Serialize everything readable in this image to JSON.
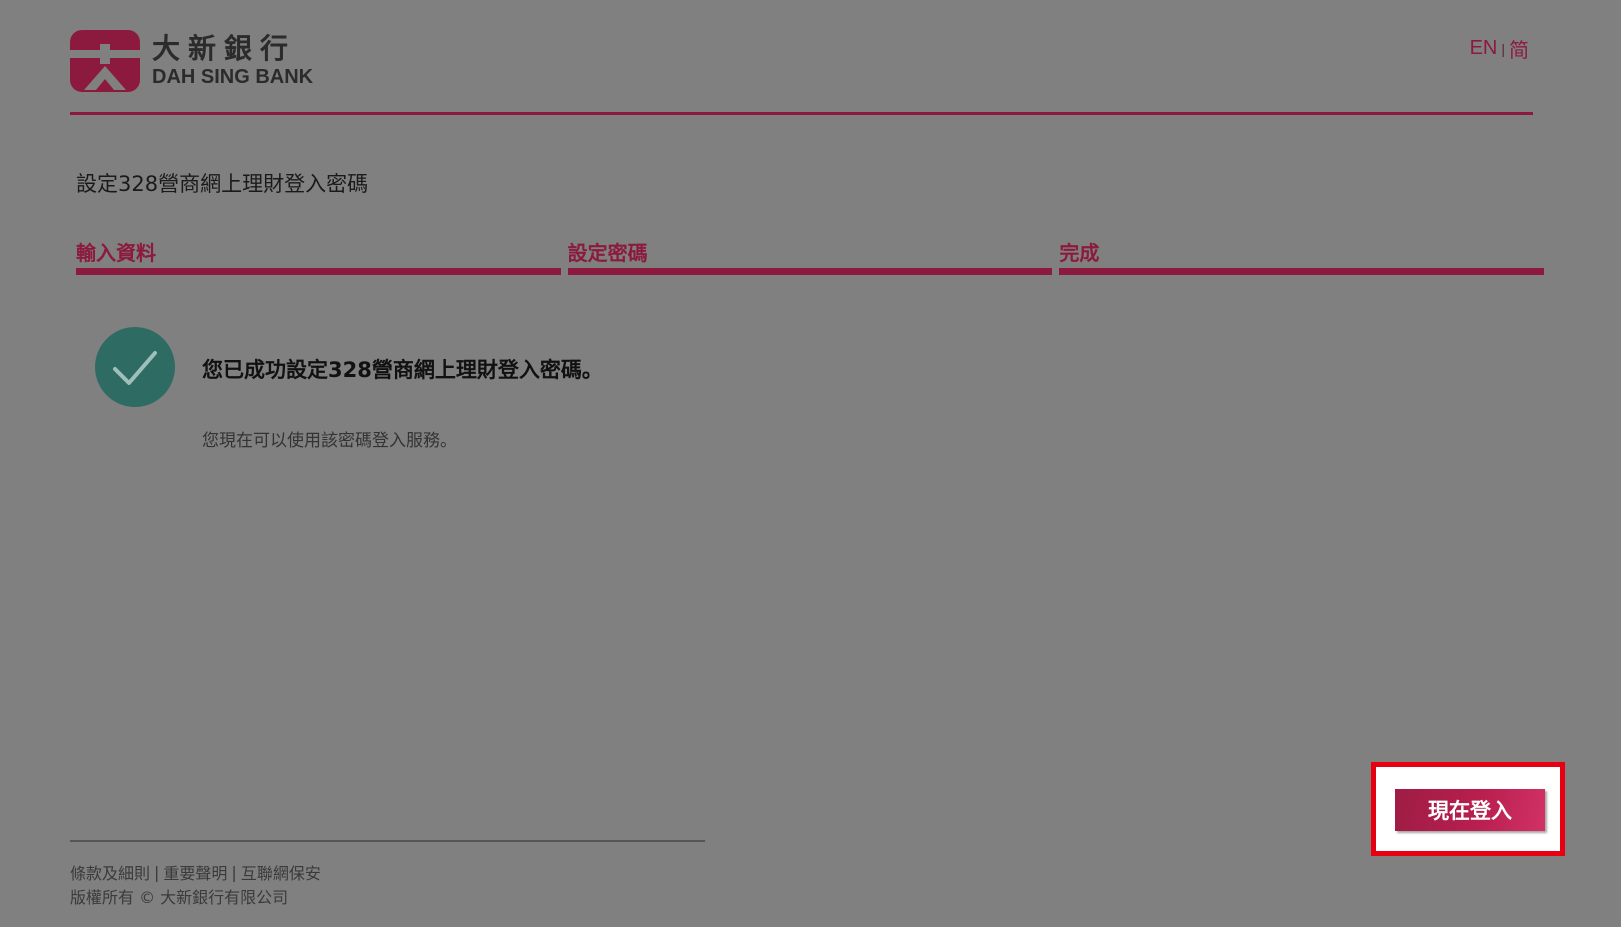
{
  "header": {
    "logo_cn": "大新銀行",
    "logo_en": "DAH SING BANK",
    "lang_en": "EN",
    "lang_sep": "|",
    "lang_sc": "简"
  },
  "page_title": "設定328營商網上理財登入密碼",
  "steps": [
    {
      "label": "輸入資料"
    },
    {
      "label": "設定密碼"
    },
    {
      "label": "完成"
    }
  ],
  "success": {
    "title": "您已成功設定328營商網上理財登入密碼。",
    "subtitle": "您現在可以使用該密碼登入服務。"
  },
  "login_button": {
    "label": "現在登入"
  },
  "footer": {
    "links": [
      "條款及細則",
      "重要聲明",
      "互聯網保安"
    ],
    "separator": "|",
    "copyright": "版權所有 © 大新銀行有限公司"
  },
  "colors": {
    "brand": "#8c1a3e",
    "success": "#2e6b63",
    "highlight": "#e60012",
    "overlay_bg": "#808080"
  }
}
